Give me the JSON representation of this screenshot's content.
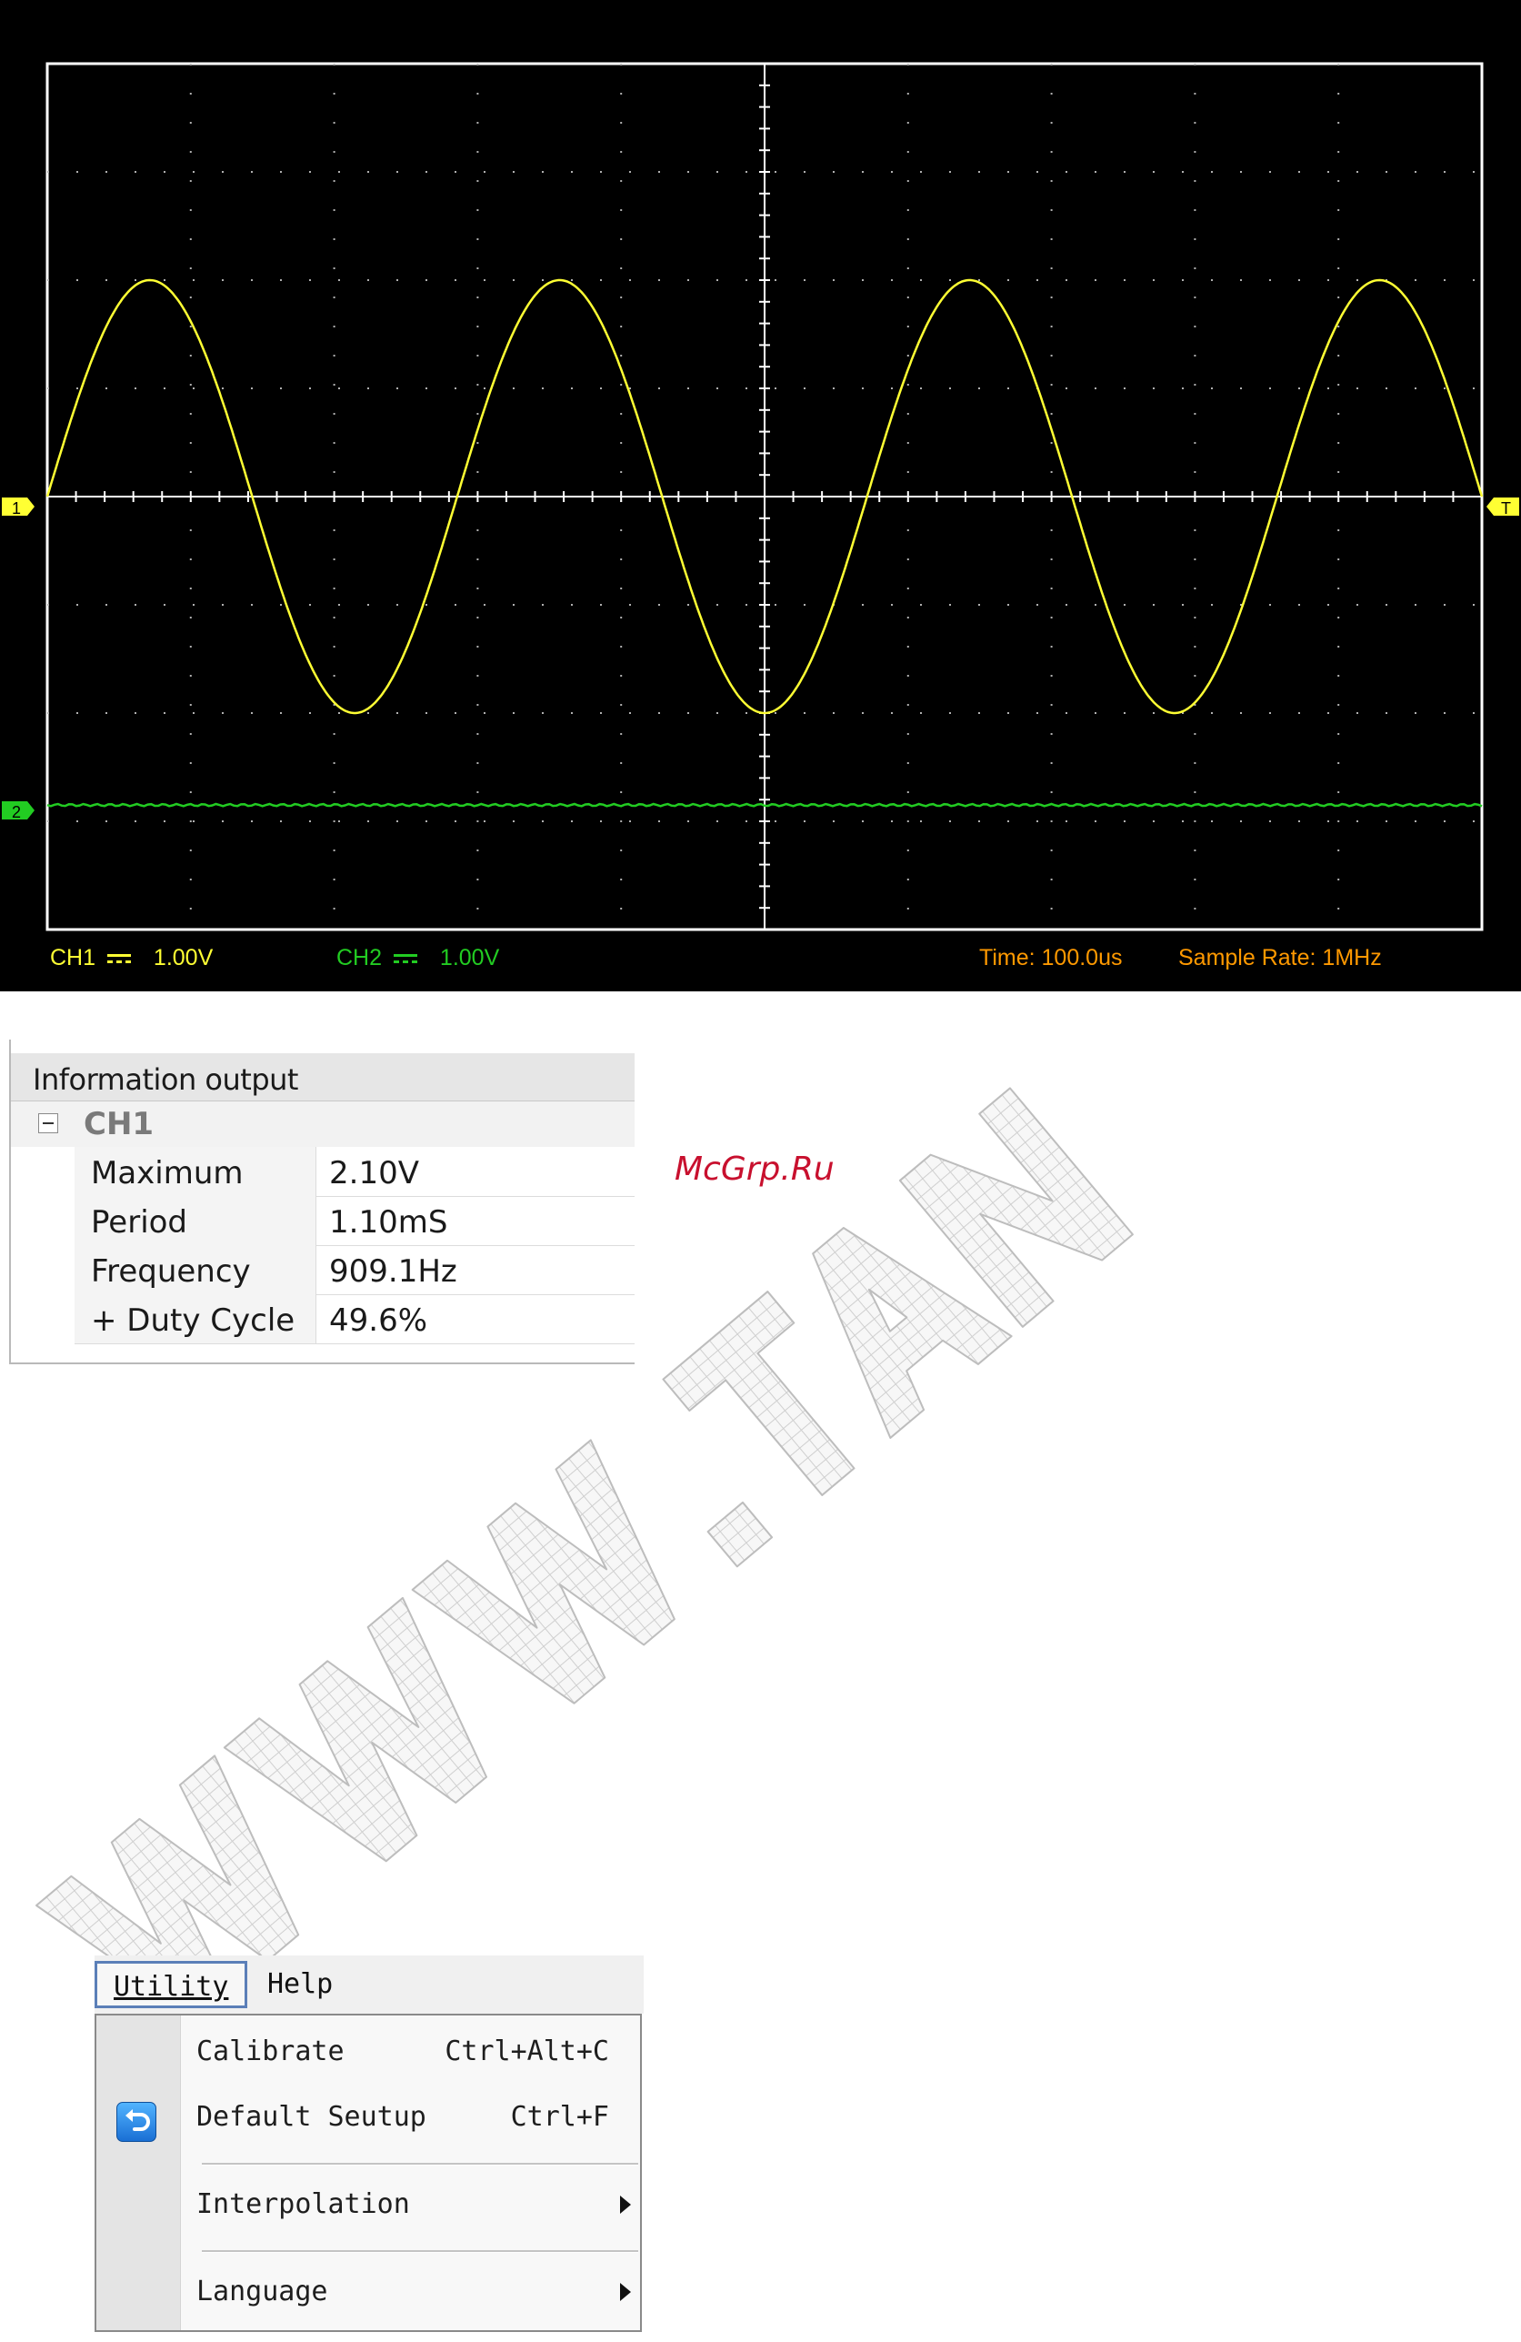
{
  "scope": {
    "colors": {
      "background": "#000000",
      "frame": "#ffffff",
      "grid": "#b0b0b0",
      "ch1": "#ffff33",
      "ch2": "#22cc22",
      "status": "#ff9900"
    },
    "ch1_marker": "1",
    "ch2_marker": "2",
    "trigger_marker": "T",
    "ch1_status": {
      "label": "CH1",
      "coupling_icon": "dc-coupling-icon",
      "scale": "1.00V"
    },
    "ch2_status": {
      "label": "CH2",
      "coupling_icon": "dc-coupling-icon",
      "scale": "1.00V"
    },
    "time_status": "Time: 100.0us",
    "sample_rate_status": "Sample Rate: 1MHz",
    "ch1_waveform": {
      "type": "sine",
      "cycles_on_screen": 3.5,
      "amplitude_divisions": 2,
      "offset_divisions": 0
    },
    "ch2_waveform": {
      "type": "flat",
      "offset_divisions": -2.85
    }
  },
  "info": {
    "title": "Information output",
    "channel": "CH1",
    "rows": [
      {
        "name": "Maximum",
        "value": "2.10V"
      },
      {
        "name": "Period",
        "value": "1.10mS"
      },
      {
        "name": "Frequency",
        "value": "909.1Hz"
      },
      {
        "name": "+ Duty Cycle",
        "value": "49.6%"
      }
    ]
  },
  "watermark": {
    "site": "McGrp.Ru"
  },
  "menu": {
    "utility_label": "Utility",
    "help_label": "Help",
    "items": [
      {
        "label": "Calibrate",
        "shortcut": "Ctrl+Alt+C"
      },
      {
        "label": "Default Seutup",
        "shortcut": "Ctrl+F",
        "icon": "default-setup-icon"
      },
      {
        "label": "Interpolation",
        "submenu": true
      },
      {
        "label": "Language",
        "submenu": true
      }
    ]
  }
}
